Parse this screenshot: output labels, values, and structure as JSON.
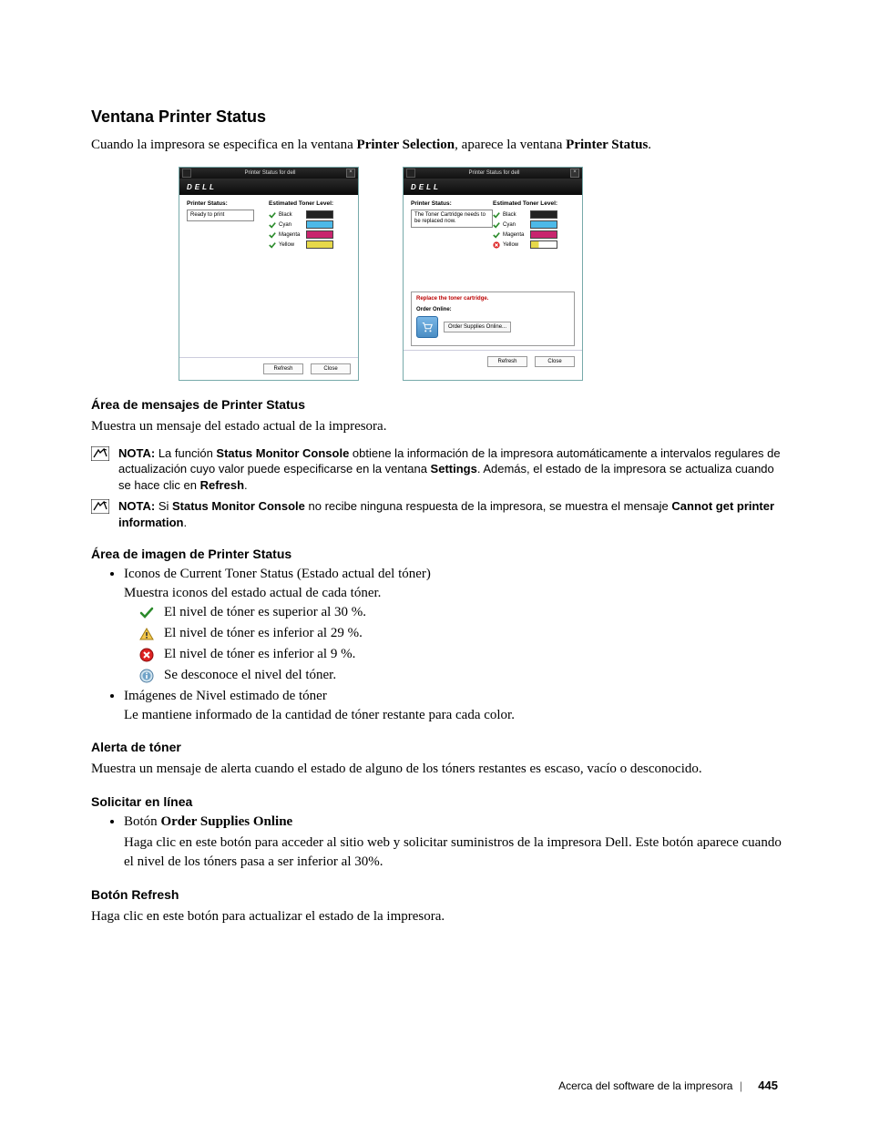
{
  "headings": {
    "main": "Ventana Printer Status",
    "area_msg": "Área de mensajes de Printer Status",
    "area_img": "Área de imagen de Printer Status",
    "alerta": "Alerta de tóner",
    "solicitar": "Solicitar en línea",
    "refresh": "Botón Refresh"
  },
  "intro": {
    "pre": "Cuando la impresora se especifica en la ventana ",
    "b1": "Printer Selection",
    "mid": ", aparece la ventana ",
    "b2": "Printer Status",
    "end": "."
  },
  "shots": {
    "title": "Printer Status for dell",
    "brand": "DELL",
    "psLabel": "Printer Status:",
    "tonerLabel": "Estimated Toner Level:",
    "ready": "Ready to print",
    "warn": "The Toner Cartridge needs to be replaced now.",
    "toners": [
      "Black",
      "Cyan",
      "Magenta",
      "Yellow"
    ],
    "replace": "Replace the toner cartridge.",
    "orderOnline": "Order Online:",
    "orderBtn": "Order Supplies Online...",
    "refresh": "Refresh",
    "close": "Close"
  },
  "areaMsgPara": "Muestra un mensaje del estado actual de la impresora.",
  "note1": {
    "l": "NOTA:",
    "p1": " La función ",
    "b1": "Status Monitor Console",
    "p2": " obtiene la información de la impresora automáticamente a intervalos regulares de actualización cuyo valor puede especificarse en la ventana ",
    "b2": "Settings",
    "p3": ". Además, el estado de la impresora se actualiza cuando se hace clic en ",
    "b3": "Refresh",
    "p4": "."
  },
  "note2": {
    "l": "NOTA:",
    "p1": " Si ",
    "b1": "Status Monitor Console",
    "p2": " no recibe ninguna respuesta de la impresora, se muestra el mensaje ",
    "b2": "Cannot get printer information",
    "p3": "."
  },
  "bullets": {
    "b1": "Iconos de Current Toner Status (Estado actual del tóner)",
    "b1sub": "Muestra iconos del estado actual de cada tóner.",
    "i1": "El nivel de tóner es superior al 30 %.",
    "i2": "El nivel de tóner es inferior al 29 %.",
    "i3": "El nivel de tóner es inferior al 9 %.",
    "i4": "Se desconoce el nivel del tóner.",
    "b2": "Imágenes de Nivel estimado de tóner",
    "b2sub": "Le mantiene informado de la cantidad de tóner restante para cada color."
  },
  "alertaPara": "Muestra un mensaje de alerta cuando el estado de alguno de los tóners restantes es escaso, vacío o desconocido.",
  "solicitar": {
    "bpre": "Botón ",
    "bname": "Order Supplies Online",
    "desc": "Haga clic en este botón para acceder al sitio web y solicitar suministros de la impresora Dell. Este botón aparece cuando el nivel de los tóners pasa a ser inferior al 30%."
  },
  "refreshPara": "Haga clic en este botón para actualizar el estado de la impresora.",
  "footer": {
    "text": "Acerca del software de la impresora",
    "page": "445"
  }
}
